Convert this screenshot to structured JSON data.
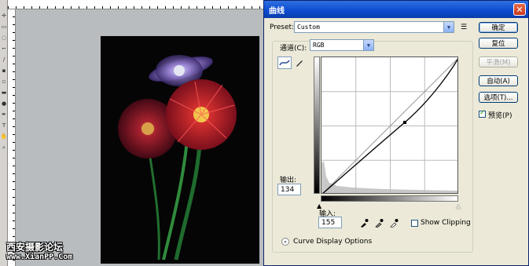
{
  "dialog": {
    "title": "曲线",
    "close_label": "✕",
    "preset_label": "Preset:",
    "preset_value": "Custom",
    "channel_label": "通道(C):",
    "channel_value": "RGB",
    "output_label": "输出:",
    "output_value": "134",
    "input_label": "输入:",
    "input_value": "155",
    "show_clipping_label": "Show Clipping",
    "show_clipping_checked": false,
    "curve_display_options_label": "Curve Display Options",
    "buttons": {
      "ok": "确定",
      "reset": "复位",
      "smooth": "平滑(M)",
      "auto": "自动(A)",
      "options": "选项(T)...",
      "preview": "预览(P)"
    },
    "preview_checked": true,
    "curve_point": {
      "input": 155,
      "output": 134
    }
  },
  "watermark": {
    "line1": "西安摄影论坛",
    "line2": "www.XianPP.Com"
  },
  "icons": {
    "close": "close-icon",
    "preset_menu": "preset-options-icon",
    "curve_tool": "curve-point-icon",
    "pencil_tool": "pencil-icon",
    "black_point": "black-eyedropper-icon",
    "gray_point": "gray-eyedropper-icon",
    "white_point": "white-eyedropper-icon"
  },
  "colors": {
    "titlebar": "#0b4ad0",
    "dialog_bg": "#ece9d8"
  }
}
